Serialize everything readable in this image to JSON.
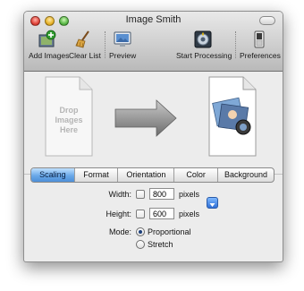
{
  "window": {
    "title": "Image Smith"
  },
  "toolbar": {
    "add_images": "Add Images",
    "clear_list": "Clear List",
    "preview": "Preview",
    "start_processing": "Start Processing",
    "preferences": "Preferences"
  },
  "drop_zone": {
    "label": "Drop Images Here"
  },
  "tabs": [
    {
      "label": "Scaling",
      "active": true
    },
    {
      "label": "Format",
      "active": false
    },
    {
      "label": "Orientation",
      "active": false
    },
    {
      "label": "Color",
      "active": false
    },
    {
      "label": "Background",
      "active": false
    }
  ],
  "scaling": {
    "width_label": "Width:",
    "width_value": "800",
    "width_units": "pixels",
    "height_label": "Height:",
    "height_value": "600",
    "height_units": "pixels",
    "mode_label": "Mode:",
    "mode_options": [
      "Proportional",
      "Stretch"
    ],
    "mode_selected": "Proportional"
  },
  "colors": {
    "accent": "#4d8fd8"
  }
}
